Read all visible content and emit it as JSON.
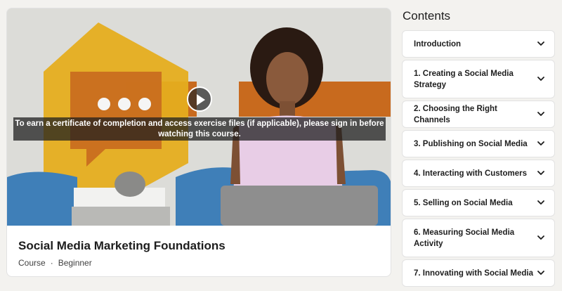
{
  "video": {
    "notice": "To earn a certificate of completion and access exercise files (if applicable), please sign in before watching this course."
  },
  "course": {
    "title": "Social Media Marketing Foundations",
    "type": "Course",
    "separator": "·",
    "level": "Beginner"
  },
  "contents": {
    "title": "Contents",
    "sections": [
      {
        "label": "Introduction"
      },
      {
        "label": "1. Creating a Social Media Strategy"
      },
      {
        "label": "2. Choosing the Right Channels"
      },
      {
        "label": "3. Publishing on Social Media"
      },
      {
        "label": "4. Interacting with Customers"
      },
      {
        "label": "5. Selling on Social Media"
      },
      {
        "label": "6. Measuring Social Media Activity"
      },
      {
        "label": "7. Innovating with Social Media"
      }
    ]
  },
  "colors": {
    "hexagon": "#e5ad1f",
    "stripe": "#c86a1e",
    "chair": "#3f7fb8"
  }
}
